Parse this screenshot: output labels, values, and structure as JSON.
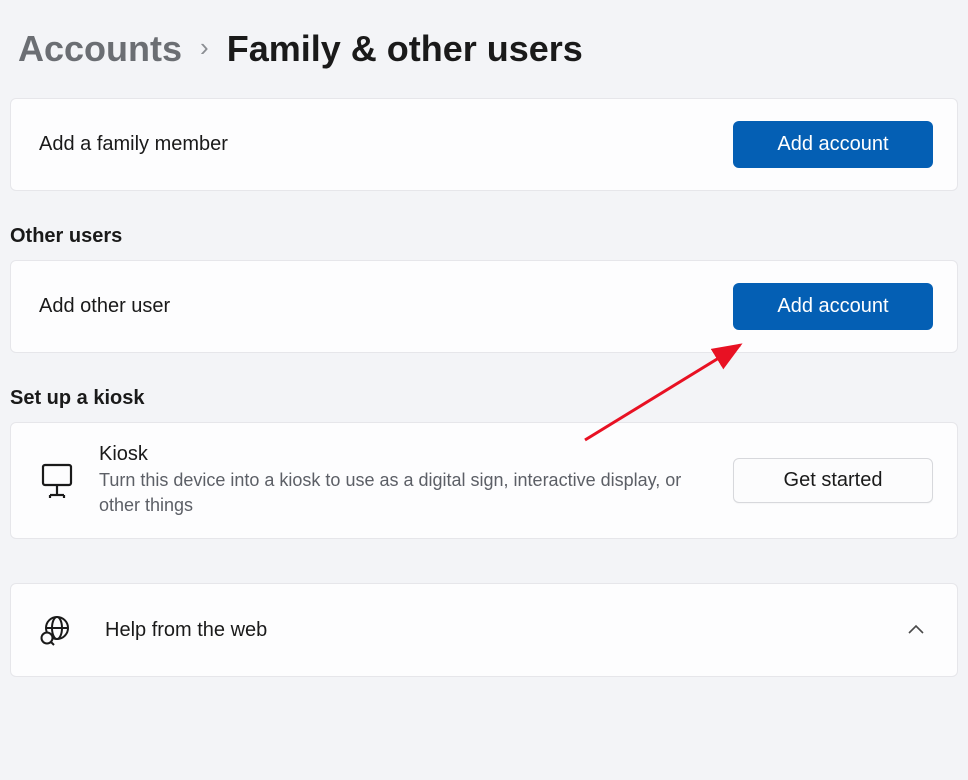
{
  "breadcrumb": {
    "parent": "Accounts",
    "current": "Family & other users"
  },
  "family": {
    "label": "Add a family member",
    "button": "Add account"
  },
  "other_users": {
    "header": "Other users",
    "label": "Add other user",
    "button": "Add account"
  },
  "kiosk": {
    "header": "Set up a kiosk",
    "title": "Kiosk",
    "description": "Turn this device into a kiosk to use as a digital sign, interactive display, or other things",
    "button": "Get started"
  },
  "help": {
    "label": "Help from the web"
  }
}
